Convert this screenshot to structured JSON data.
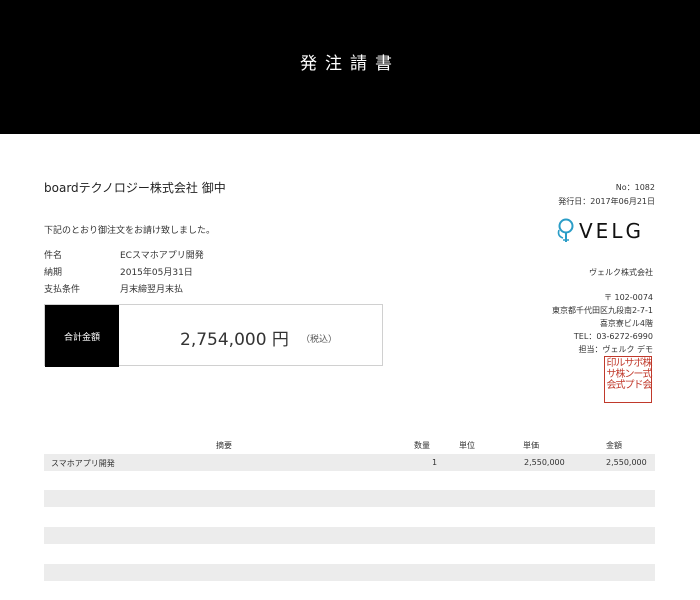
{
  "header": {
    "title": "発注請書"
  },
  "recipient": "boardテクノロジー株式会社 御中",
  "intro": "下記のとおり御注文をお請け致しました。",
  "terms": [
    {
      "label": "件名",
      "value": "ECスマホアプリ開発"
    },
    {
      "label": "納期",
      "value": "2015年05月31日"
    },
    {
      "label": "支払条件",
      "value": "月末締翌月末払"
    }
  ],
  "total": {
    "label": "合計金額",
    "amount": "2,754,000 円",
    "tax_note": "（税込）"
  },
  "document": {
    "number": "No：1082",
    "issue_date": "発行日：2017年06月21日"
  },
  "logo": {
    "text": "VELG"
  },
  "company": {
    "name": "ヴェルク株式会社",
    "postal": "〒 102-0074",
    "address1": "東京都千代田区九段南2-7-1",
    "address2": "喜京寮ビル4階",
    "tel": "TEL：03-6272-6990",
    "contact": "担当：ヴェルク デモ"
  },
  "seal": {
    "columns": [
      "株式会",
      "ボード",
      "サンプ",
      "ル株式",
      "印サ会"
    ]
  },
  "table": {
    "headers": {
      "description": "摘要",
      "quantity": "数量",
      "unit": "単位",
      "unit_price": "単価",
      "amount": "金額"
    },
    "rows": [
      {
        "description": "スマホアプリ開発",
        "quantity": "1",
        "unit": "",
        "unit_price": "2,550,000",
        "amount": "2,550,000"
      },
      {
        "description": "",
        "quantity": "",
        "unit": "",
        "unit_price": "",
        "amount": ""
      },
      {
        "description": "",
        "quantity": "",
        "unit": "",
        "unit_price": "",
        "amount": ""
      },
      {
        "description": "",
        "quantity": "",
        "unit": "",
        "unit_price": "",
        "amount": ""
      },
      {
        "description": "",
        "quantity": "",
        "unit": "",
        "unit_price": "",
        "amount": ""
      },
      {
        "description": "",
        "quantity": "",
        "unit": "",
        "unit_price": "",
        "amount": ""
      },
      {
        "description": "",
        "quantity": "",
        "unit": "",
        "unit_price": "",
        "amount": ""
      }
    ]
  },
  "colors": {
    "header_bg": "#000000",
    "row_bg": "#ececec",
    "seal": "#c0392b",
    "logo_accent": "#2a9dc7"
  },
  "icons": {
    "logo_mark": "lightbulb-icon"
  }
}
